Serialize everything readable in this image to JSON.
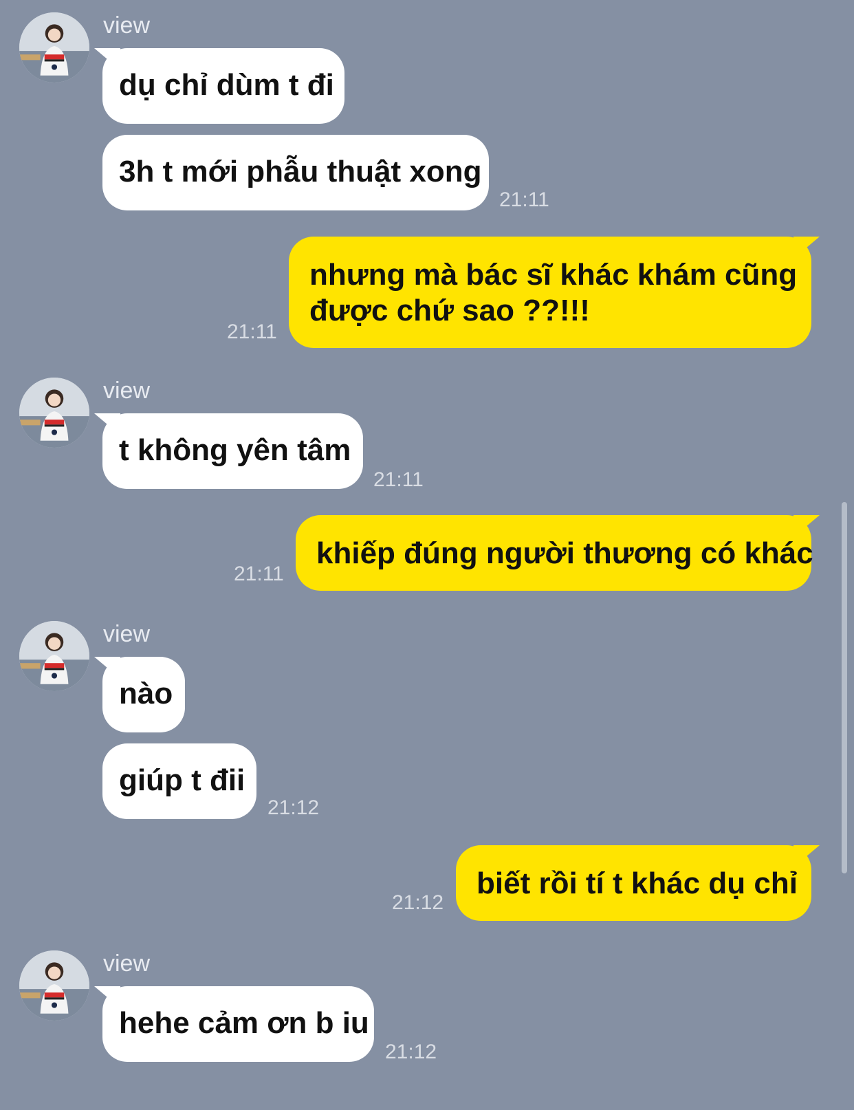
{
  "chat": {
    "messages": [
      {
        "kind": "avatar",
        "name": "contact-avatar"
      },
      {
        "kind": "sender",
        "text": "view"
      },
      {
        "kind": "bubble-in",
        "text": "dụ chỉ dùm t đi",
        "tail": true
      },
      {
        "kind": "bubble-in",
        "text": "3h t mới phẫu thuật xong",
        "tail": false
      },
      {
        "kind": "time",
        "text": "21:11"
      },
      {
        "kind": "bubble-out",
        "text": "nhưng mà bác sĩ khác khám cũng\nđược chứ sao ??!!!",
        "tail": true
      },
      {
        "kind": "time",
        "text": "21:11"
      },
      {
        "kind": "avatar",
        "name": "contact-avatar"
      },
      {
        "kind": "sender",
        "text": "view"
      },
      {
        "kind": "bubble-in",
        "text": "t không yên tâm",
        "tail": true
      },
      {
        "kind": "time",
        "text": "21:11"
      },
      {
        "kind": "bubble-out",
        "text": "khiếp đúng người thương có khác",
        "tail": true
      },
      {
        "kind": "time",
        "text": "21:11"
      },
      {
        "kind": "avatar",
        "name": "contact-avatar"
      },
      {
        "kind": "sender",
        "text": "view"
      },
      {
        "kind": "bubble-in",
        "text": "nào",
        "tail": true
      },
      {
        "kind": "bubble-in",
        "text": "giúp t đii",
        "tail": false
      },
      {
        "kind": "time",
        "text": "21:12"
      },
      {
        "kind": "bubble-out",
        "text": "biết rồi tí t khác dụ chỉ",
        "tail": true
      },
      {
        "kind": "time",
        "text": "21:12"
      },
      {
        "kind": "avatar",
        "name": "contact-avatar"
      },
      {
        "kind": "sender",
        "text": "view"
      },
      {
        "kind": "bubble-in",
        "text": "hehe cảm ơn b iu",
        "tail": true
      },
      {
        "kind": "time",
        "text": "21:12"
      }
    ]
  },
  "colors": {
    "background": "#8590a3",
    "incoming_bubble": "#ffffff",
    "outgoing_bubble": "#ffe400",
    "timestamp": "#d9dde4",
    "sender_name": "#e8ebf1"
  }
}
